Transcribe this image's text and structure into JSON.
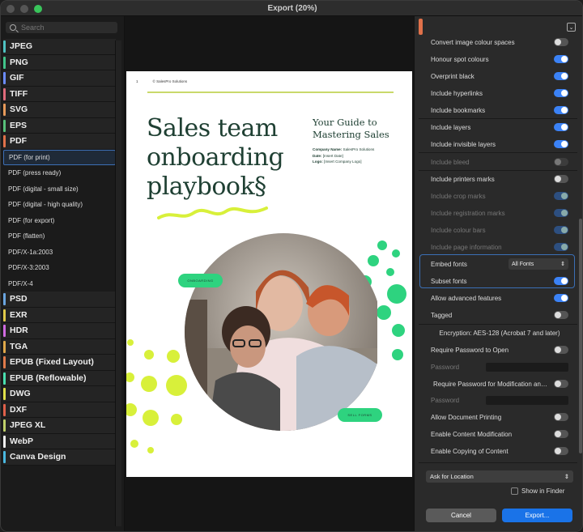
{
  "window": {
    "title": "Export (20%)"
  },
  "sidebar": {
    "search_placeholder": "Search",
    "formats_top": [
      {
        "label": "JPEG",
        "color": "#4fc3c3"
      },
      {
        "label": "PNG",
        "color": "#41c48a"
      },
      {
        "label": "GIF",
        "color": "#6b8cff"
      },
      {
        "label": "TIFF",
        "color": "#e06b7a"
      },
      {
        "label": "SVG",
        "color": "#e79a5a"
      },
      {
        "label": "EPS",
        "color": "#58c07a"
      },
      {
        "label": "PDF",
        "color": "#e0714a"
      }
    ],
    "pdf_presets": [
      "PDF (for print)",
      "PDF (press ready)",
      "PDF (digital - small size)",
      "PDF (digital - high quality)",
      "PDF (for export)",
      "PDF (flatten)",
      "PDF/X-1a:2003",
      "PDF/X-3:2003",
      "PDF/X-4"
    ],
    "formats_bottom": [
      {
        "label": "PSD",
        "color": "#6aa5e0"
      },
      {
        "label": "EXR",
        "color": "#e0c94a"
      },
      {
        "label": "HDR",
        "color": "#d06be0"
      },
      {
        "label": "TGA",
        "color": "#e0a94a"
      },
      {
        "label": "EPUB (Fixed Layout)",
        "color": "#e07a4a"
      },
      {
        "label": "EPUB (Reflowable)",
        "color": "#4ae0b0"
      },
      {
        "label": "DWG",
        "color": "#e0e04a"
      },
      {
        "label": "DXF",
        "color": "#e0604a"
      },
      {
        "label": "JPEG XL",
        "color": "#c0d06a"
      },
      {
        "label": "WebP",
        "color": "#eeeeee"
      },
      {
        "label": "Canva Design",
        "color": "#4ab8e0"
      }
    ]
  },
  "page": {
    "page_number": "1",
    "copyright": "© SalesPro Solutions",
    "headline": [
      "Sales team",
      "onboarding",
      "playbook§"
    ],
    "guide_title": [
      "Your Guide to",
      "Mastering Sales"
    ],
    "meta": [
      {
        "key": "Company Name:",
        "value": " SalesPro Solutions"
      },
      {
        "key": "Date:",
        "value": " [Insert Date]"
      },
      {
        "key": "Logo:",
        "value": " [Insert Company Logo]"
      }
    ],
    "tag_left": "ONBOARDING",
    "tag_right": "SELL FORMS"
  },
  "options": {
    "convert_colour_spaces": "Convert image colour spaces",
    "honour_spot": "Honour spot colours",
    "overprint_black": "Overprint black",
    "include_hyperlinks": "Include hyperlinks",
    "include_bookmarks": "Include bookmarks",
    "include_layers": "Include layers",
    "include_invisible_layers": "Include invisible layers",
    "include_bleed": "Include bleed",
    "include_printers_marks": "Include printers marks",
    "include_crop_marks": "Include crop marks",
    "include_registration_marks": "Include registration marks",
    "include_colour_bars": "Include colour bars",
    "include_page_information": "Include page information",
    "embed_fonts": "Embed fonts",
    "embed_fonts_value": "All Fonts",
    "subset_fonts": "Subset fonts",
    "allow_advanced": "Allow advanced features",
    "tagged": "Tagged",
    "encryption": "Encryption: AES-128 (Acrobat 7 and later)",
    "require_password_open": "Require Password to Open",
    "password": "Password",
    "require_password_mod": "Require Password for Modification an…",
    "allow_printing": "Allow Document Printing",
    "enable_modification": "Enable Content Modification",
    "enable_copying": "Enable Copying of Content"
  },
  "footer": {
    "location": "Ask for Location",
    "show_in_finder": "Show in Finder",
    "cancel": "Cancel",
    "export": "Export..."
  },
  "colors": {
    "accent": "#3b82f6",
    "export_button": "#1a73e8",
    "pdf_tab": "#e0714a",
    "page_green": "#2ed37f",
    "page_lime": "#d8f03a"
  }
}
